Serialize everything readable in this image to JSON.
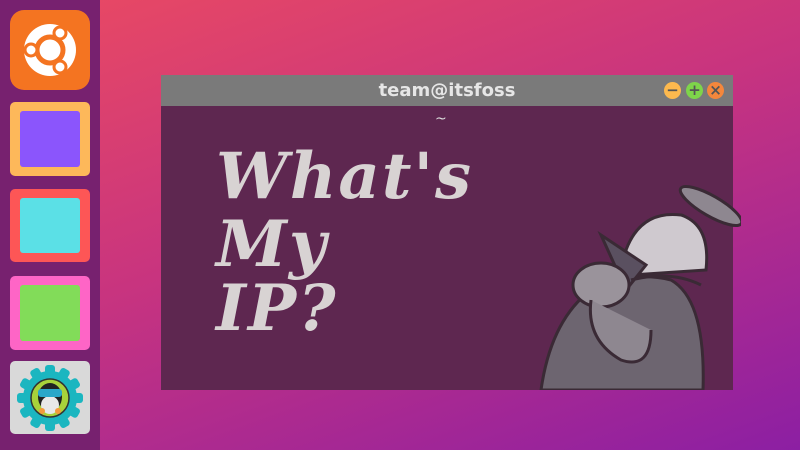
{
  "dock": {
    "items": [
      {
        "name": "ubuntu-launcher",
        "icon": "ubuntu-logo-icon",
        "color": "#f47421"
      },
      {
        "name": "app-purple",
        "border": "#fdb85a",
        "fill": "#8b55fc"
      },
      {
        "name": "app-cyan",
        "border": "#fd5656",
        "fill": "#5be0e6"
      },
      {
        "name": "app-green",
        "border": "#fe65c6",
        "fill": "#82dc59"
      },
      {
        "name": "itsfoss-app",
        "icon": "itsfoss-penguin-gear-icon"
      }
    ]
  },
  "window": {
    "title": "team@itsfoss",
    "prompt": "~",
    "headline": [
      "What's",
      "My",
      "IP?"
    ],
    "controls": {
      "minimize": "minimize-icon",
      "maximize": "maximize-icon",
      "close": "close-icon"
    }
  }
}
